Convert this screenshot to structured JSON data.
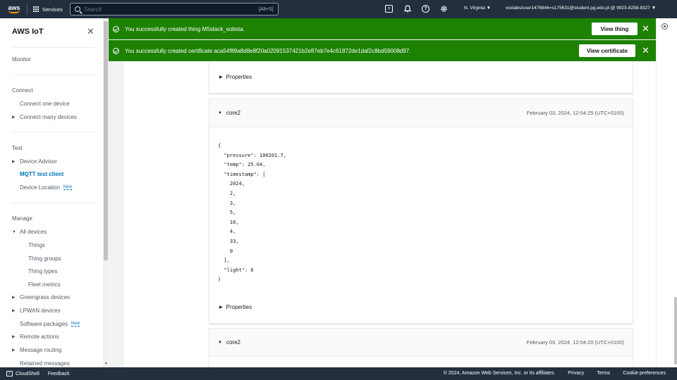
{
  "topnav": {
    "logo_text": "aws",
    "services_label": "Services",
    "search_placeholder": "Search",
    "search_shortcut": "[Alt+S]",
    "region": "N. Virginia ▼",
    "account": "voclabs/user1476844=s175631@student.pg.edu.pl @ 9923-8258-8327 ▼",
    "icons": [
      "cloudshell-icon",
      "bell-icon",
      "help-icon",
      "gear-icon"
    ]
  },
  "sidebar": {
    "title": "AWS IoT",
    "items": [
      {
        "label": "Monitor"
      },
      {
        "label": "Connect"
      },
      {
        "label": "Connect one device"
      },
      {
        "label": "Connect many devices"
      },
      {
        "label": "Test"
      },
      {
        "label": "Device Advisor"
      },
      {
        "label": "MQTT test client"
      },
      {
        "label": "Device Location"
      },
      {
        "label": "Manage"
      },
      {
        "label": "All devices"
      },
      {
        "label": "Things"
      },
      {
        "label": "Thing groups"
      },
      {
        "label": "Thing types"
      },
      {
        "label": "Fleet metrics"
      },
      {
        "label": "Greengrass devices"
      },
      {
        "label": "LPWAN devices"
      },
      {
        "label": "Software packages"
      },
      {
        "label": "Remote actions"
      },
      {
        "label": "Message routing"
      },
      {
        "label": "Retained messages"
      }
    ],
    "new_badge": "New"
  },
  "flash": [
    {
      "text": "You successfully created thing M5stack_sobota.",
      "button": "View thing"
    },
    {
      "text": "You successfully created certificate aca54f89a8d8e8f20a02091537421b2e87eb7e4c61872de1daf2c8bd59008d97.",
      "button": "View certificate"
    }
  ],
  "messages": [
    {
      "topic": "core2",
      "timestamp": "February 03, 2024, 12:04:25 (UTC+0100)",
      "payload": "{\n  \"pressure\": 100201.7,\n  \"temp\": 25.04,\n  \"timestamp\": [\n    2024,\n    2,\n    3,\n    5,\n    10,\n    4,\n    33,\n    0\n  ],\n  \"light\": 6\n}",
      "properties_label": "Properties"
    },
    {
      "topic": "core2",
      "timestamp": "February 03, 2024, 12:04:20 (UTC+0100)"
    }
  ],
  "prev_properties_label": "Properties",
  "footer": {
    "cloudshell": "CloudShell",
    "feedback": "Feedback",
    "copyright": "© 2024, Amazon Web Services, Inc. or its affiliates.",
    "privacy": "Privacy",
    "terms": "Terms",
    "cookies": "Cookie preferences"
  },
  "colors": {
    "nav_bg": "#232f3e",
    "success_green": "#1d8102",
    "link_blue": "#0073bb",
    "aws_orange": "#ff9900"
  }
}
